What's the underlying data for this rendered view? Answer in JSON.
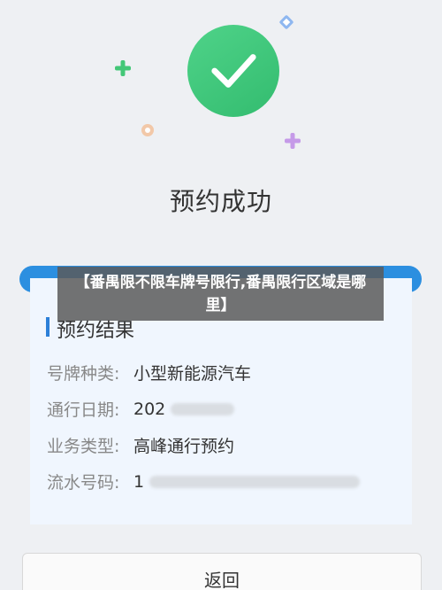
{
  "header": {
    "title": "预约成功",
    "status_icon": "check-circle-icon",
    "accent_color": "#3ec57a"
  },
  "overlay": {
    "text": "【番禺限不限车牌号限行,番禺限行区域是哪里】"
  },
  "result": {
    "section_title": "预约结果",
    "rows": [
      {
        "label": "号牌种类:",
        "value": "小型新能源汽车"
      },
      {
        "label": "通行日期:",
        "value": "202"
      },
      {
        "label": "业务类型:",
        "value": "高峰通行预约"
      },
      {
        "label": "流水号码:",
        "value": "1"
      }
    ]
  },
  "footer": {
    "back_label": "返回"
  },
  "colors": {
    "card_band": "#2c8fe0",
    "card_bg": "#f0f6fe",
    "section_bar": "#2c7fd8"
  }
}
